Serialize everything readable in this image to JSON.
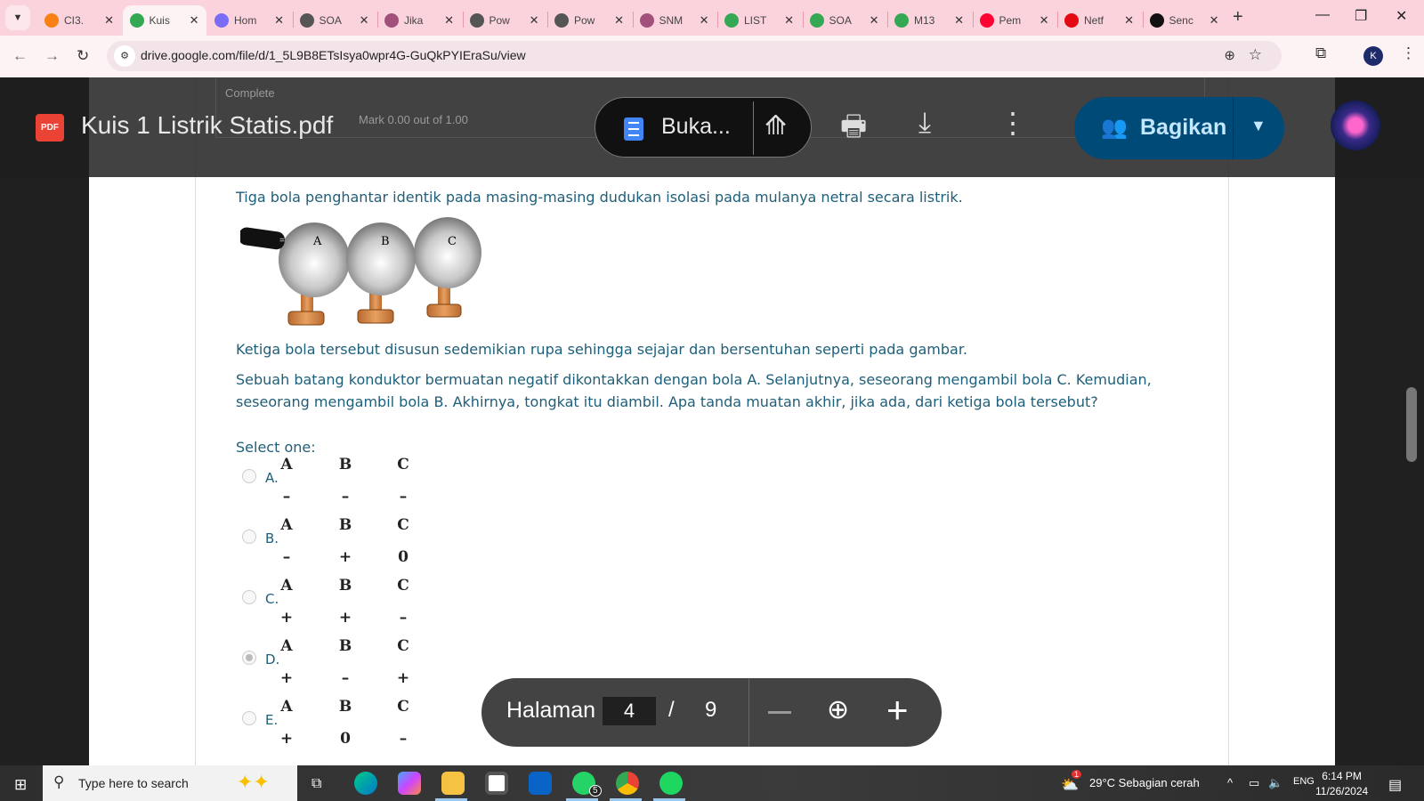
{
  "browser": {
    "tabs": [
      {
        "title": "CI3.",
        "icon": "moodle-icon",
        "color": "#f98012"
      },
      {
        "title": "Kuis",
        "icon": "google-drive-icon",
        "color": "#34a853",
        "active": true
      },
      {
        "title": "Hom",
        "icon": "gem-icon",
        "color": "#7b6cf6"
      },
      {
        "title": "SOA",
        "icon": "globe-icon",
        "color": "#555555"
      },
      {
        "title": "Jika",
        "icon": "app-icon",
        "color": "#a0507a"
      },
      {
        "title": "Pow",
        "icon": "globe-icon",
        "color": "#555555"
      },
      {
        "title": "Pow",
        "icon": "globe-icon",
        "color": "#555555"
      },
      {
        "title": "SNM",
        "icon": "app-icon",
        "color": "#a0507a"
      },
      {
        "title": "LIST",
        "icon": "google-drive-icon",
        "color": "#34a853"
      },
      {
        "title": "SOA",
        "icon": "google-drive-icon",
        "color": "#34a853"
      },
      {
        "title": "M13",
        "icon": "google-drive-icon",
        "color": "#34a853"
      },
      {
        "title": "Pem",
        "icon": "youtube-icon",
        "color": "#ff0033"
      },
      {
        "title": "Netf",
        "icon": "netflix-icon",
        "color": "#e50914"
      },
      {
        "title": "Senc",
        "icon": "tiktok-icon",
        "color": "#111111"
      }
    ],
    "url": "drive.google.com/file/d/1_5L9B8ETsIsya0wpr4G-GuQkPYIEraSu/view",
    "profile_initial": "K"
  },
  "viewer": {
    "file_title": "Kuis 1 Listrik Statis.pdf",
    "pdf_badge": "PDF",
    "open_with_label": "Buka...",
    "share_label": "Bagikan",
    "share_color": "#004a77",
    "background_page": {
      "status": "Complete",
      "mark": "Mark 0.00 out of 1.00"
    },
    "page_label": "Halaman",
    "current_page": "4",
    "separator": "/",
    "total_pages": "9"
  },
  "question": {
    "intro": "Tiga bola penghantar identik pada masing-masing dudukan isolasi pada mulanya netral secara listrik.",
    "figure_labels": [
      "A",
      "B",
      "C"
    ],
    "arrangement": "Ketiga bola tersebut disusun sedemikian rupa sehingga sejajar dan bersentuhan seperti pada gambar.",
    "body": "Sebuah batang konduktor bermuatan negatif dikontakkan dengan bola A. Selanjutnya, seseorang mengambil bola C. Kemudian, seseorang mengambil bola B. Akhirnya, tongkat itu diambil. Apa tanda muatan akhir, jika ada, dari ketiga bola tersebut?",
    "prompt": "Select one:",
    "text_color": "#1e5f7a",
    "options": [
      {
        "letter": "A.",
        "headers": [
          "A",
          "B",
          "C"
        ],
        "values": [
          "–",
          "–",
          "–"
        ],
        "selected": false
      },
      {
        "letter": "B.",
        "headers": [
          "A",
          "B",
          "C"
        ],
        "values": [
          "–",
          "+",
          "0"
        ],
        "selected": false
      },
      {
        "letter": "C.",
        "headers": [
          "A",
          "B",
          "C"
        ],
        "values": [
          "+",
          "+",
          "–"
        ],
        "selected": false
      },
      {
        "letter": "D.",
        "headers": [
          "A",
          "B",
          "C"
        ],
        "values": [
          "+",
          "–",
          "+"
        ],
        "selected": true
      },
      {
        "letter": "E.",
        "headers": [
          "A",
          "B",
          "C"
        ],
        "values": [
          "+",
          "0",
          "–"
        ],
        "selected": false
      }
    ]
  },
  "taskbar": {
    "search_placeholder": "Type here to search",
    "whatsapp_badge": "5",
    "weather": "29°C  Sebagian cerah",
    "weather_badge": "1",
    "language": "ENG",
    "time": "6:14 PM",
    "date": "11/26/2024"
  }
}
